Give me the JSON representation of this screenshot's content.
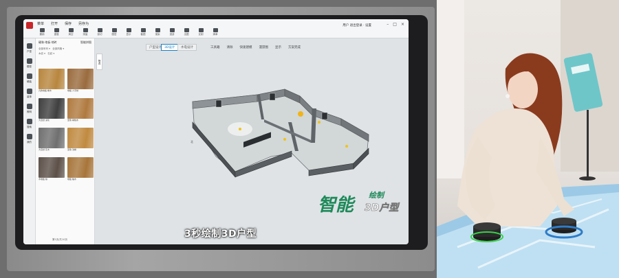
{
  "app": {
    "menu": [
      "菜单",
      "打开",
      "保存",
      "另存为"
    ],
    "tools": [
      "撤销",
      "重做",
      "清空",
      "测量",
      "剖切",
      "图层",
      "显示",
      "截图",
      "渲染",
      "漫游",
      "出图",
      "定制",
      "清单"
    ],
    "user": "用户",
    "user_action": "退出登录",
    "settings_label": "设置"
  },
  "rail": {
    "items": [
      "户型",
      "模型",
      "硬装",
      "装饰",
      "照明",
      "搜索",
      "我的"
    ]
  },
  "panel": {
    "title": "硬装·地板·地砖",
    "subtitle": "智能拼图",
    "filter1": "全部系列",
    "filter2": "全部风格",
    "filter3": "木纹",
    "filter4": "石纹",
    "side_tab": "筛选",
    "footer": "第1页/共10页",
    "tiles": [
      {
        "color": "#b8863e",
        "cap": "九牧地板·橡木"
      },
      {
        "color": "#9a6b3d",
        "cap": "地板·人字拼"
      },
      {
        "color": "#3f3f3f",
        "cap": "大自然·深灰"
      },
      {
        "color": "#b07a3f",
        "cap": "圣象·胡桃木"
      },
      {
        "color": "#6f6f6f",
        "cap": "大自然·灰木"
      },
      {
        "color": "#c08a40",
        "cap": "圣象·浅橡"
      },
      {
        "color": "#5c5048",
        "cap": "木地板·棕"
      },
      {
        "color": "#a7753a",
        "cap": "地板·柚木"
      },
      {
        "color": "#2f3336",
        "cap": "地砖·深灰"
      },
      {
        "color": "#a07a55",
        "cap": "地砖·木纹"
      },
      {
        "color": "#7a6552",
        "cap": "地板·烟熏"
      },
      {
        "color": "#8a7a6a",
        "cap": "地板·橡灰"
      }
    ]
  },
  "canvas": {
    "tab1": "户型设计",
    "tab2": "3D设计",
    "tab3": "水电设计",
    "tools": [
      "工具箱",
      "清除",
      "快速建模",
      "漫游图",
      "显示",
      "方案完成"
    ],
    "compass": "北",
    "caption": "3秒绘制3D户型",
    "badge_main": "智能",
    "badge_sub": "绘制",
    "badge_accent": "3D户型"
  },
  "colors": {
    "accent_red": "#c8262a",
    "badge_green": "#1f8a5a"
  }
}
